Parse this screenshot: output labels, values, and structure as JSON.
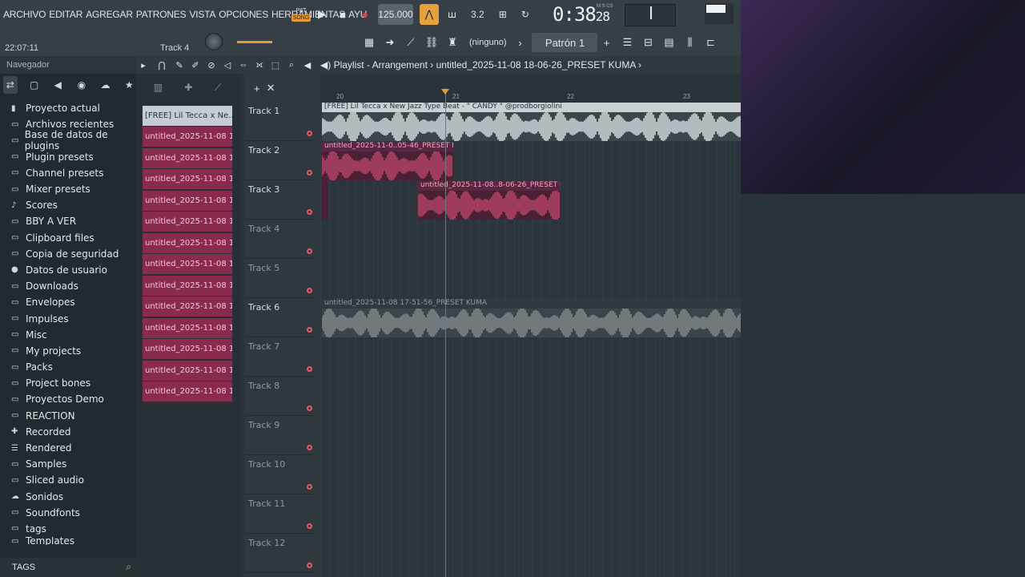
{
  "menu": [
    "ARCHIVO",
    "EDITAR",
    "AGREGAR",
    "PATRONES",
    "VISTA",
    "OPCIONES",
    "HERRAMIENTAS",
    "AYU"
  ],
  "hint_time": "22:07:11",
  "hint_track": "Track 4",
  "transport": {
    "pat": "PAT",
    "song": "SONG",
    "tempo": "125.000",
    "clock_main": "0:38",
    "clock_sub": "28",
    "clock_label": "M:S:CS"
  },
  "toolbar": {
    "ninguno": "(ninguno)",
    "patron": "Patrón 1"
  },
  "browser": {
    "title": "Navegador",
    "items": [
      "Proyecto actual",
      "Archivos recientes",
      "Base de datos de plugins",
      "Plugin presets",
      "Channel presets",
      "Mixer presets",
      "Scores",
      "BBY A VER",
      "Clipboard files",
      "Copia de seguridad",
      "Datos de usuario",
      "Downloads",
      "Envelopes",
      "Impulses",
      "Misc",
      "My projects",
      "Packs",
      "Project bones",
      "Proyectos Demo",
      "REACTION",
      "Recorded",
      "Rendered",
      "Samples",
      "Sliced audio",
      "Sonidos",
      "Soundfonts",
      "tags",
      "Templates"
    ],
    "footer": "TAGS"
  },
  "playlist": {
    "title": "Playlist - Arrangement",
    "project": "untitled_2025-11-08 18-06-26_PRESET KUMA"
  },
  "picker_clips": [
    "[FREE] Lil Tecca x Ne..",
    "untitled_2025-11-08 17-..",
    "untitled_2025-11-08 17-..",
    "untitled_2025-11-08 17-..",
    "untitled_2025-11-08 17-..",
    "untitled_2025-11-08 17-..",
    "untitled_2025-11-08 17-..",
    "untitled_2025-11-08 17-..",
    "untitled_2025-11-08 17-..",
    "untitled_2025-11-08 18-..",
    "untitled_2025-11-08 18-..",
    "untitled_2025-11-08 18-..",
    "untitled_2025-11-08 18-..",
    "untitled_2025-11-08 18-.."
  ],
  "tracks": [
    "Track 1",
    "Track 2",
    "Track 3",
    "Track 4",
    "Track 5",
    "Track 6",
    "Track 7",
    "Track 8",
    "Track 9",
    "Track 10",
    "Track 11",
    "Track 12"
  ],
  "ruler": [
    "20",
    "21",
    "22",
    "23"
  ],
  "clips": {
    "t1": "[FREE] Lil Tecca x New Jazz Type Beat - \" CANDY \" @prodborgiolini",
    "t2": "untitled_2025-11-0..05-46_PRESET KUMA",
    "t3": "untitled_2025-11-08..8-06-26_PRESET KUMA",
    "t6": "untitled_2025-11-08 17-51-56_PRESET KUMA"
  },
  "colors": {
    "accent": "#e49a3a",
    "clip_pink": "#c2486f",
    "clip_white": "#e8edf0",
    "clip_grey": "#8b8f93"
  }
}
